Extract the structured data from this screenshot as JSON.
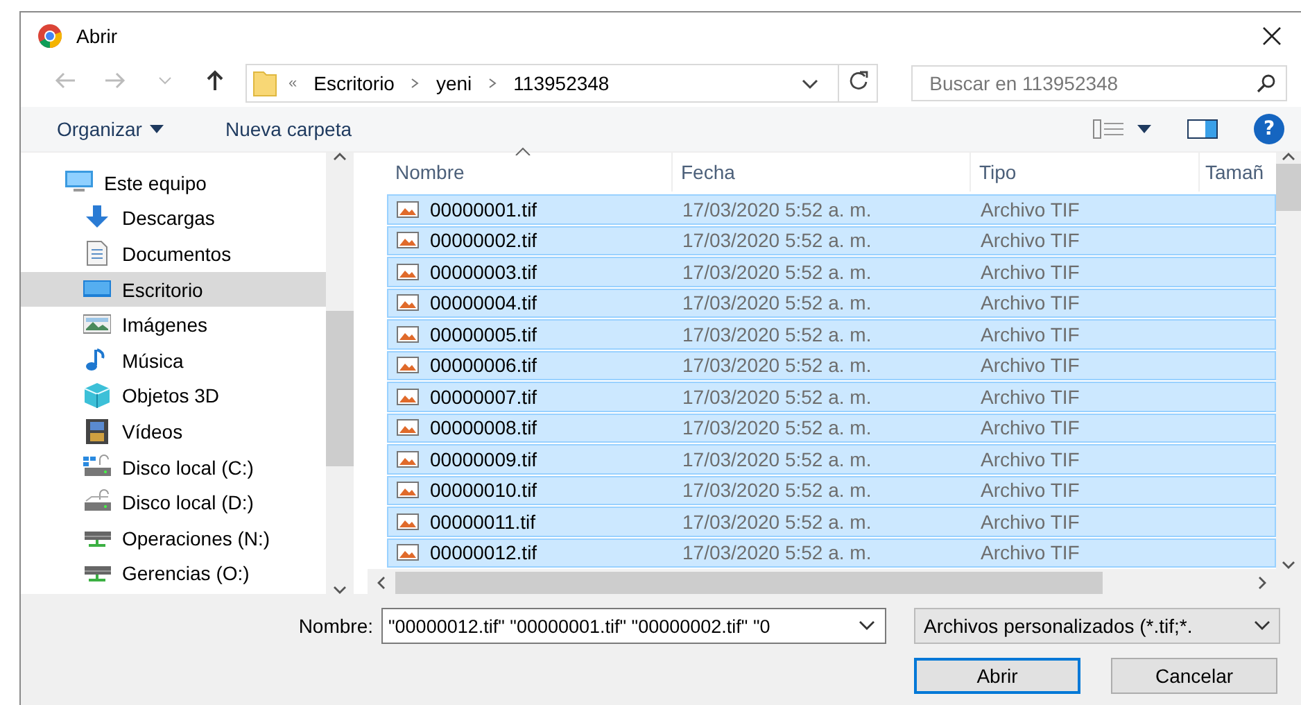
{
  "window": {
    "title": "Abrir"
  },
  "address": {
    "overflow": "«",
    "crumbs": [
      "Escritorio",
      "yeni",
      "113952348"
    ]
  },
  "search": {
    "placeholder": "Buscar en 113952348"
  },
  "toolbar": {
    "organize": "Organizar",
    "new_folder": "Nueva carpeta",
    "help": "?"
  },
  "sidebar": {
    "items": [
      {
        "label": "Este equipo",
        "kind": "computer",
        "selected": false,
        "children": [
          {
            "label": "Descargas",
            "kind": "download",
            "selected": false
          },
          {
            "label": "Documentos",
            "kind": "documents",
            "selected": false
          },
          {
            "label": "Escritorio",
            "kind": "desktop",
            "selected": true
          },
          {
            "label": "Imágenes",
            "kind": "pictures",
            "selected": false
          },
          {
            "label": "Música",
            "kind": "music",
            "selected": false
          },
          {
            "label": "Objetos 3D",
            "kind": "objects",
            "selected": false
          },
          {
            "label": "Vídeos",
            "kind": "videos",
            "selected": false
          },
          {
            "label": "Disco local (C:)",
            "kind": "system-drive",
            "selected": false
          },
          {
            "label": "Disco local (D:)",
            "kind": "drive",
            "selected": false
          },
          {
            "label": "Operaciones (N:)",
            "kind": "network",
            "selected": false
          },
          {
            "label": "Gerencias (O:)",
            "kind": "network",
            "selected": false
          }
        ]
      }
    ]
  },
  "table": {
    "columns": [
      {
        "label": "Nombre",
        "sorted": true
      },
      {
        "label": "Fecha",
        "sorted": false
      },
      {
        "label": "Tipo",
        "sorted": false
      },
      {
        "label": "Tamañ",
        "sorted": false
      }
    ],
    "rows": [
      {
        "name": "00000001.tif",
        "date": "17/03/2020 5:52 a. m.",
        "type": "Archivo TIF",
        "selected": true
      },
      {
        "name": "00000002.tif",
        "date": "17/03/2020 5:52 a. m.",
        "type": "Archivo TIF",
        "selected": true
      },
      {
        "name": "00000003.tif",
        "date": "17/03/2020 5:52 a. m.",
        "type": "Archivo TIF",
        "selected": true
      },
      {
        "name": "00000004.tif",
        "date": "17/03/2020 5:52 a. m.",
        "type": "Archivo TIF",
        "selected": true
      },
      {
        "name": "00000005.tif",
        "date": "17/03/2020 5:52 a. m.",
        "type": "Archivo TIF",
        "selected": true
      },
      {
        "name": "00000006.tif",
        "date": "17/03/2020 5:52 a. m.",
        "type": "Archivo TIF",
        "selected": true
      },
      {
        "name": "00000007.tif",
        "date": "17/03/2020 5:52 a. m.",
        "type": "Archivo TIF",
        "selected": true
      },
      {
        "name": "00000008.tif",
        "date": "17/03/2020 5:52 a. m.",
        "type": "Archivo TIF",
        "selected": true
      },
      {
        "name": "00000009.tif",
        "date": "17/03/2020 5:52 a. m.",
        "type": "Archivo TIF",
        "selected": true
      },
      {
        "name": "00000010.tif",
        "date": "17/03/2020 5:52 a. m.",
        "type": "Archivo TIF",
        "selected": true
      },
      {
        "name": "00000011.tif",
        "date": "17/03/2020 5:52 a. m.",
        "type": "Archivo TIF",
        "selected": true
      },
      {
        "name": "00000012.tif",
        "date": "17/03/2020 5:52 a. m.",
        "type": "Archivo TIF",
        "selected": true
      }
    ]
  },
  "footer": {
    "name_label": "Nombre:",
    "name_value": "\"00000012.tif\" \"00000001.tif\" \"00000002.tif\" \"0",
    "filter": "Archivos personalizados (*.tif;*.",
    "open": "Abrir",
    "cancel": "Cancelar"
  }
}
